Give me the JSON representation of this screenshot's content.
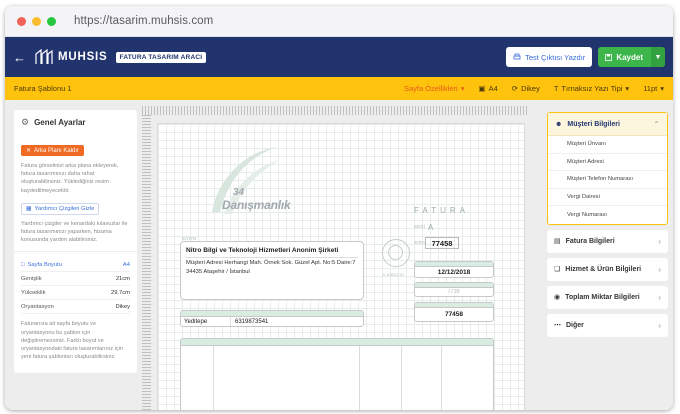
{
  "browser": {
    "url": "https://tasarim.muhsis.com"
  },
  "header": {
    "logo": "MUHSIS",
    "badge": "FATURA TASARIM ARACI",
    "preview_label": "Test Çıktısı Yazdır",
    "save_label": "Kaydet"
  },
  "toolbar": {
    "title": "Fatura Şablonu 1",
    "page_size_label": "Sayfa Özellikleri",
    "size_label": "A4",
    "orientation_label": "Dikey",
    "font_label": "Tırnaksız Yazı Tipi",
    "font_size_label": "11pt"
  },
  "left_panel": {
    "title": "Genel Ayarlar",
    "remove_bg_button": "Arka Planı Kaldır",
    "bg_desc": "Fatura görselinizi arka plana ekleyerek, fatura tasarımınızı daha rahat oluşturabilirsiniz. Yüklediğiniz resim kaydedilmeyecektir.",
    "hide_guides_button": "Yardımcı Çizgileri Gizle",
    "guides_desc": "Yardımcı çizgiler ve kenardaki kılavuzlar ile fatura tasarımınızı yaparken, hizama konusunda yardım alabilirsiniz.",
    "page_size_label": "Sayfa Boyutu",
    "page_size_value": "A4",
    "width_label": "Genişlik",
    "width_value": "21cm",
    "height_label": "Yükseklik",
    "height_value": "29.7cm",
    "orientation_label": "Oryantasyon",
    "orientation_value": "Dikey",
    "footer_desc": "Faturanıza ait sayfa boyutu ve oryantasyonu bu şablon için değiştiremezsiniz. Farklı boyut ve oryantasyondaki fatura tasarımlarınız için yeni fatura şablonları oluşturabilirsiniz."
  },
  "invoice": {
    "logo_number": "34",
    "logo_name": "Danışmanlık",
    "title": "FATURA",
    "seri_label": "SERİ",
    "seri_value": "A",
    "sira_label": "SIRA",
    "sira_value": "77458",
    "sayin_label": "SAYIN",
    "customer_name": "Nitro Bilgi ve Teknoloji Hizmetleri Anonim Şirketi",
    "customer_address": "Müşteri Adresi Herhangi Mah. Örnek Sok. Güzel Apt. No:5 Daire:7 34435 Ataşehir / İstanbul",
    "stamp_text": "K.KÜDÜ 34",
    "date_value": "12/12/2018",
    "time_value": "/    /  20",
    "dispatch_value": "77458",
    "tax_office": "Yeditepe",
    "tax_number": "6319873541"
  },
  "right_panel": {
    "sections": [
      {
        "label": "Müşteri Bilgileri",
        "icon": "user-icon",
        "open": true,
        "items": [
          "Müşteri Ünvanı",
          "Müşteri Adresi",
          "Müşteri Telefon Numarası",
          "Vergi Dairesi",
          "Vergi Numarası"
        ]
      },
      {
        "label": "Fatura Bilgileri",
        "icon": "document-icon"
      },
      {
        "label": "Hizmet & Ürün Bilgileri",
        "icon": "box-icon"
      },
      {
        "label": "Toplam Miktar Bilgileri",
        "icon": "coin-icon"
      },
      {
        "label": "Diğer",
        "icon": "more-icon"
      }
    ]
  },
  "colors": {
    "header": "#22346e",
    "toolbar": "#ffc20d",
    "save": "#3cb54a",
    "orange": "#f06a24",
    "accent": "#3a6fd8"
  }
}
